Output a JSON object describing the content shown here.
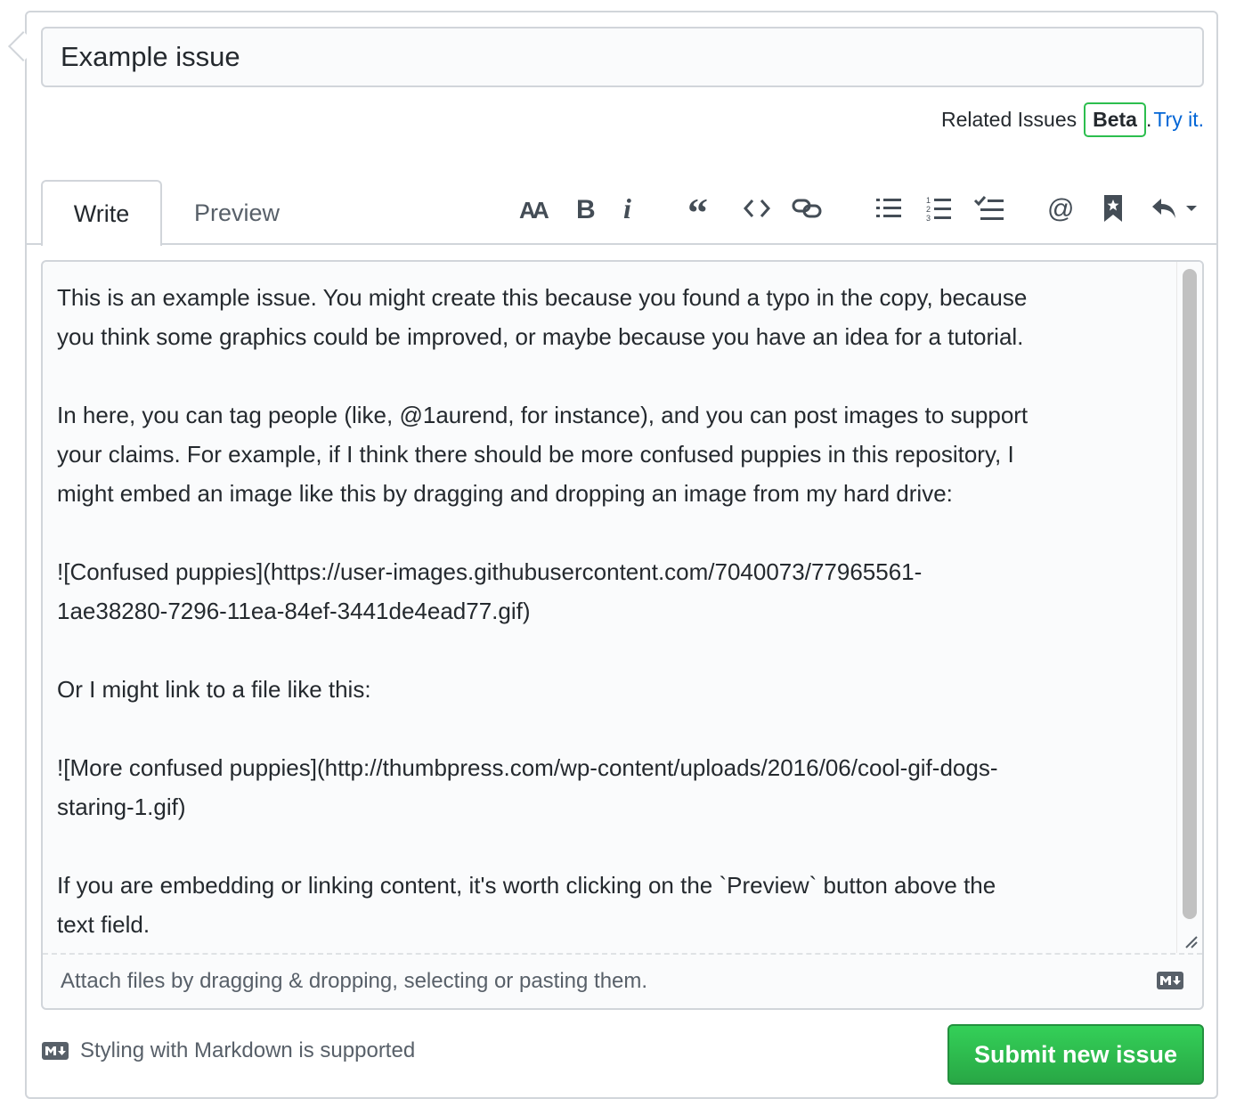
{
  "issue": {
    "title_value": "Example issue"
  },
  "related": {
    "label": "Related Issues",
    "badge": "Beta",
    "period": ".",
    "link": "Try it."
  },
  "tabs": [
    {
      "label": "Write"
    },
    {
      "label": "Preview"
    }
  ],
  "toolbar": [
    {
      "icon": "text-size-icon"
    },
    {
      "icon": "bold-icon"
    },
    {
      "icon": "italic-icon"
    },
    {
      "icon": "quote-icon"
    },
    {
      "icon": "code-icon"
    },
    {
      "icon": "link-icon"
    },
    {
      "icon": "unordered-list-icon"
    },
    {
      "icon": "ordered-list-icon"
    },
    {
      "icon": "task-list-icon"
    },
    {
      "icon": "mention-icon"
    },
    {
      "icon": "bookmark-icon"
    },
    {
      "icon": "reply-icon"
    }
  ],
  "body": {
    "lines": [
      "This is an example issue. You might create this because you found a typo in the copy, because",
      "you think some graphics could be improved, or maybe because you have an idea for a tutorial.",
      "",
      "In here, you can tag people (like, @1aurend, for instance), and you can post images to support",
      "your claims. For example, if I think there should be more confused puppies in this repository, I",
      "might embed an image like this by dragging and dropping an image from my hard drive:",
      "",
      "![Confused puppies](https://user-images.githubusercontent.com/7040073/77965561-",
      "1ae38280-7296-11ea-84ef-3441de4ead77.gif)",
      "",
      "Or I might link to a file like this:",
      "",
      "![More confused puppies](http://thumbpress.com/wp-content/uploads/2016/06/cool-gif-dogs-",
      "staring-1.gif)",
      "",
      "If you are embedding or linking content, it's worth clicking on the `Preview` button above the",
      "text field."
    ]
  },
  "attach": {
    "text": "Attach files by dragging & dropping, selecting or pasting them."
  },
  "markdown_note": "Styling with Markdown is supported",
  "submit_label": "Submit new issue",
  "colors": {
    "accent": "#0366d6",
    "submit": "#28a745",
    "beta_border": "#2cbe4e"
  }
}
